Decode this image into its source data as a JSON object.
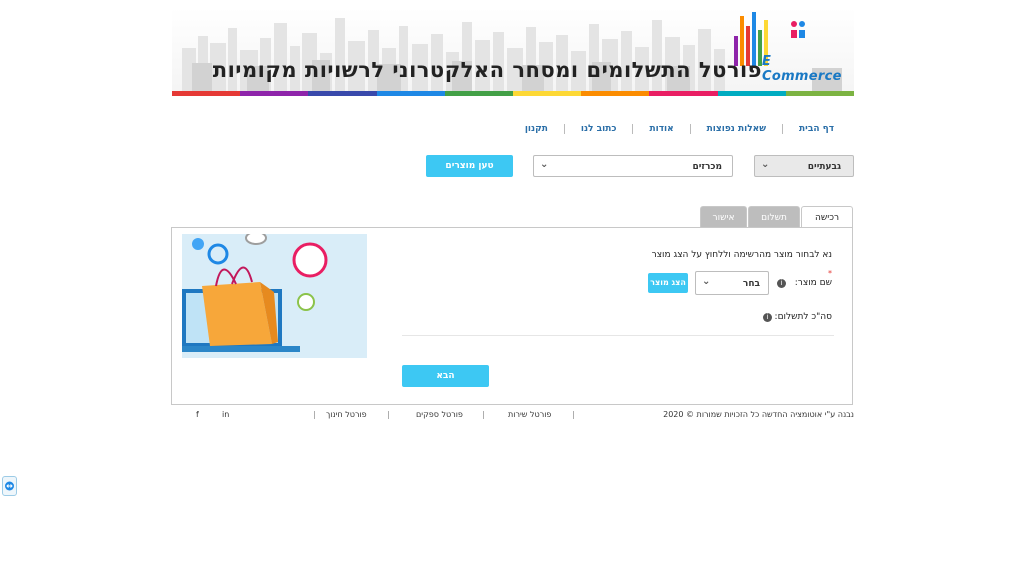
{
  "banner": {
    "title": "פורטל התשלומים ומסחר האלקטרוני לרשויות מקומיות",
    "brand": "E Commerce",
    "strip_colors": [
      "#e53935",
      "#8e24aa",
      "#3949ab",
      "#1e88e5",
      "#43a047",
      "#fdd835",
      "#fb8c00",
      "#e91e63",
      "#00acc1",
      "#7cb342"
    ]
  },
  "nav": {
    "items": [
      "דף הבית",
      "שאלות נפוצות",
      "אודות",
      "כתוב לנו",
      "תקנון"
    ]
  },
  "filters": {
    "city": "גבעתיים",
    "category": "מכרזים",
    "load_button": "טען מוצרים"
  },
  "tabs": {
    "purchase": "רכישה",
    "payment": "תשלום",
    "confirm": "אישור"
  },
  "form": {
    "instruction": "נא לבחור מוצר מהרשימה וללחוץ על הצג מוצר",
    "required_mark": "*",
    "product_label": "שם מוצר:",
    "product_value": "בחר",
    "show_button": "הצג מוצר",
    "total_label": "סה\"כ לתשלום:",
    "next_button": "הבא"
  },
  "footer": {
    "copyright": "נבנה ע\"י אוטומציה החדשה כל הזכויות שמורות © 2020",
    "links": [
      "פורטל שירות",
      "פורטל ספקים",
      "פורטל חינוך"
    ],
    "social": [
      "f",
      "in"
    ]
  },
  "icons": {
    "info": "info-icon",
    "dropdown": "chevron-down-icon"
  }
}
